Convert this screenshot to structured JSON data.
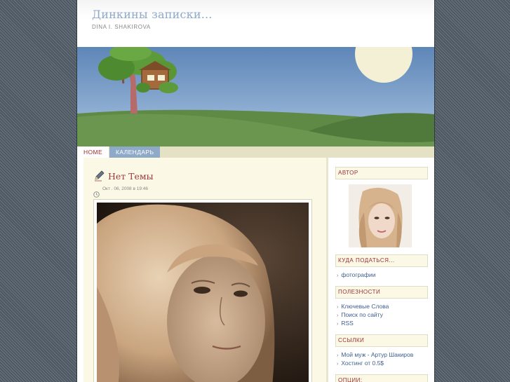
{
  "header": {
    "title": "Динкины записки...",
    "subtitle": "DINA I. SHAKIROVA"
  },
  "nav": {
    "items": [
      {
        "label": "HOME"
      },
      {
        "label": "КАЛЕНДАРЬ"
      }
    ]
  },
  "post": {
    "title": "Нет Темы",
    "date": "Окт . 06, 2008 в 19:46",
    "icon": "pencil-icon"
  },
  "sidebar": {
    "sections": [
      {
        "heading": "АВТОР"
      },
      {
        "heading": "КУДА ПОДАТЬСЯ...",
        "links": [
          "фотографии"
        ]
      },
      {
        "heading": "ПОЛЕЗНОСТИ",
        "links": [
          "Ключевые Слова",
          "Поиск по сайту",
          "RSS"
        ]
      },
      {
        "heading": "ССЫЛКИ",
        "links": [
          "Мой муж - Артур Шакиров",
          "Хостинг от 0.5$"
        ]
      },
      {
        "heading": "ОПЦИИ:"
      }
    ]
  },
  "colors": {
    "title": "#8fa9c8",
    "nav_active": "#8fa9c8",
    "accent_red": "#9c2f2f",
    "content_bg": "#fbf8e6",
    "link": "#3f5f8e"
  }
}
